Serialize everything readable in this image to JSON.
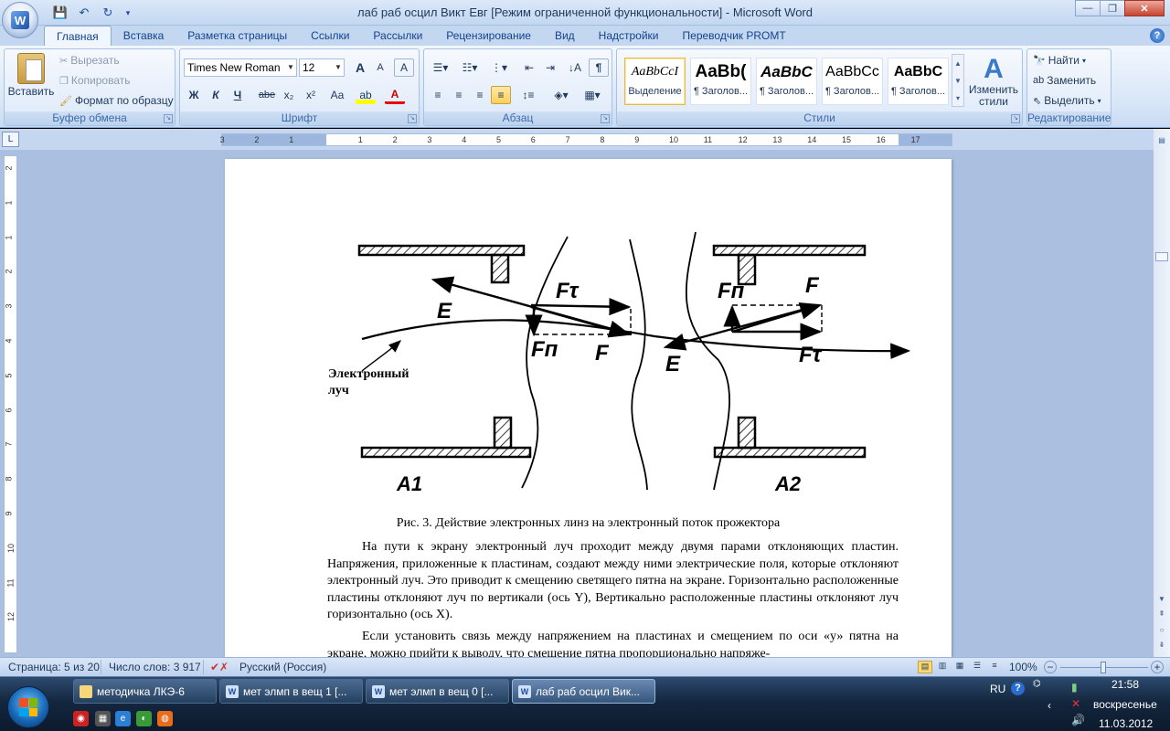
{
  "window": {
    "title": "лаб раб осцил Викт Евг [Режим ограниченной функциональности] - Microsoft Word",
    "minimize": "—",
    "maximize": "❐",
    "close": "✕"
  },
  "qat": {
    "save": "💾",
    "undo": "↶",
    "redo": "↻",
    "more": "▾"
  },
  "tabs": [
    "Главная",
    "Вставка",
    "Разметка страницы",
    "Ссылки",
    "Рассылки",
    "Рецензирование",
    "Вид",
    "Надстройки",
    "Переводчик PROMT"
  ],
  "help": "?",
  "ribbon": {
    "clipboard": {
      "label": "Буфер обмена",
      "paste": "Вставить",
      "cut": "Вырезать",
      "copy": "Копировать",
      "format_painter": "Формат по образцу"
    },
    "font": {
      "label": "Шрифт",
      "font_name": "Times New Roman",
      "font_size": "12",
      "grow": "A",
      "shrink": "A",
      "clear": "A",
      "bold": "Ж",
      "italic": "К",
      "underline": "Ч",
      "strike": "abe",
      "subscript": "x₂",
      "superscript": "x²",
      "case": "Aa",
      "highlight": "ab",
      "color": "A"
    },
    "paragraph": {
      "label": "Абзац",
      "pilcrow": "¶"
    },
    "styles": {
      "label": "Стили",
      "items": [
        {
          "preview": "AaBbCcI",
          "name": "Выделение"
        },
        {
          "preview": "AaBb(",
          "name": "¶ Заголов..."
        },
        {
          "preview": "AaBbC",
          "name": "¶ Заголов..."
        },
        {
          "preview": "AaBbCc",
          "name": "¶ Заголов..."
        },
        {
          "preview": "AaBbC",
          "name": "¶ Заголов..."
        }
      ],
      "change": "Изменить стили"
    },
    "editing": {
      "label": "Редактирование",
      "find": "Найти",
      "replace": "Заменить",
      "select": "Выделить"
    }
  },
  "ruler_btn": "L",
  "ruler_ticks": [
    "3",
    "2",
    "1",
    "1",
    "2",
    "3",
    "4",
    "5",
    "6",
    "7",
    "8",
    "9",
    "10",
    "11",
    "12",
    "13",
    "14",
    "15",
    "16",
    "17"
  ],
  "vruler_ticks": [
    "2",
    "1",
    "1",
    "2",
    "3",
    "4",
    "5",
    "6",
    "7",
    "8",
    "9",
    "10",
    "11",
    "12"
  ],
  "figure": {
    "beam_label": "Электронный луч",
    "label_E": "E",
    "label_Ft": "Fτ",
    "label_Fn": "Fп",
    "label_F": "F",
    "label_A1": "A1",
    "label_A2": "A2",
    "caption": "Рис. 3. Действие электронных линз на электронный поток прожектора"
  },
  "body": {
    "para1": "На пути к экрану электронный луч проходит между двумя парами отклоняющих пластин. Напряжения, приложенные к пластинам, создают между ними электрические поля, которые отклоняют электронный луч. Это приводит к смещению светящего пятна на экране. Горизонтально расположенные пластины отклоняют луч по вертикали (ось Y), Вертикально расположенные пластины отклоняют луч горизонтально (ось X).",
    "para2": "Если установить связь между напряжением на пластинах и смещением по оси «у» пятна на экране, можно прийти к выводу, что смещение пятна пропорционально напряже-"
  },
  "status": {
    "page": "Страница: 5 из 20",
    "words": "Число слов: 3 917",
    "lang": "Русский (Россия)",
    "zoom": "100%",
    "zoom_minus": "−",
    "zoom_plus": "+"
  },
  "taskbar": {
    "items": [
      {
        "label": "методичка ЛКЭ-6",
        "icon": "📁",
        "active": false
      },
      {
        "label": "мет элмп в вещ 1 [...",
        "icon": "W",
        "active": false
      },
      {
        "label": "мет элмп в вещ 0 [...",
        "icon": "W",
        "active": false
      },
      {
        "label": "лаб раб осцил Вик...",
        "icon": "W",
        "active": true
      }
    ],
    "lang": "RU",
    "time": "21:58",
    "day": "воскресенье",
    "date": "11.03.2012"
  },
  "colors": {
    "ribbon_text": "#15428b",
    "doc_bg": "#abc0e0",
    "taskbar": "#14273f"
  }
}
